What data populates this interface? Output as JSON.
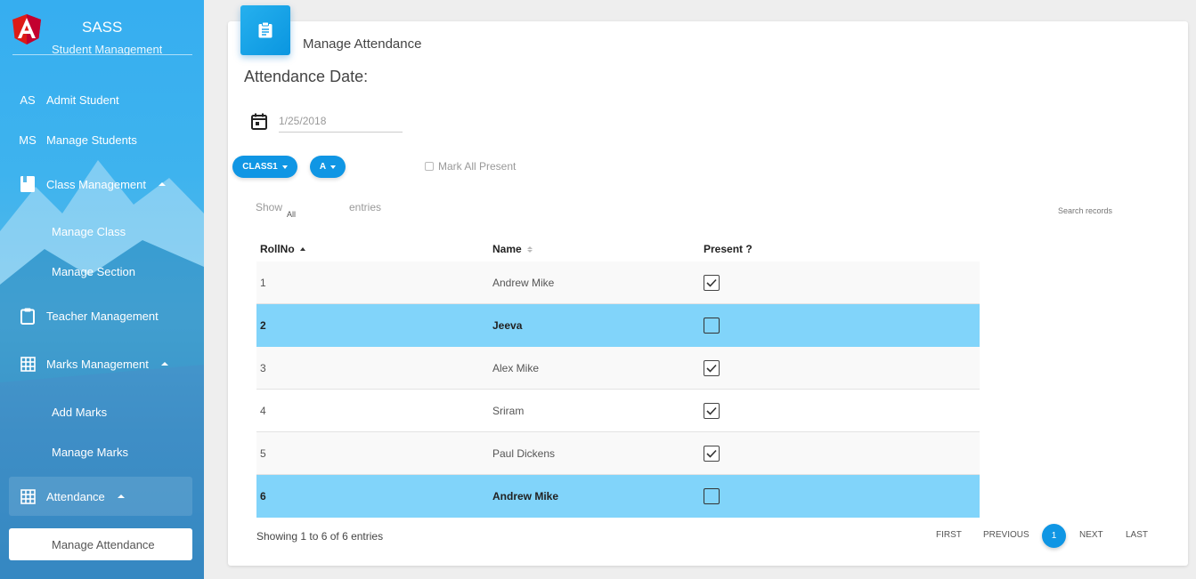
{
  "brand": {
    "name": "SASS"
  },
  "sidebar": {
    "clipped_item": "Student Management",
    "items": [
      {
        "abbr": "AS",
        "label": "Admit Student"
      },
      {
        "abbr": "MS",
        "label": "Manage Students"
      },
      {
        "icon": "book-icon",
        "label": "Class Management"
      },
      {
        "label": "Manage Class"
      },
      {
        "label": "Manage Section"
      },
      {
        "icon": "clipboard-icon",
        "label": "Teacher Management"
      },
      {
        "icon": "grid-icon",
        "label": "Marks Management"
      },
      {
        "label": "Add Marks"
      },
      {
        "label": "Manage Marks"
      },
      {
        "icon": "grid-icon",
        "label": "Attendance"
      },
      {
        "label": "Manage Attendance"
      }
    ]
  },
  "card": {
    "title": "Manage Attendance",
    "icon": "clipboard-icon",
    "attendance_label": "Attendance Date:",
    "date_value": "1/25/2018",
    "class_select": "CLASS1",
    "section_select": "A",
    "mark_all_label": "Mark All Present",
    "show_label": "Show",
    "show_value": "All",
    "entries_label": "entries",
    "search_placeholder": "Search records"
  },
  "table": {
    "headers": {
      "roll": "RollNo",
      "name": "Name",
      "present": "Present ?"
    },
    "rows": [
      {
        "roll": "1",
        "name": "Andrew Mike",
        "present": true
      },
      {
        "roll": "2",
        "name": "Jeeva",
        "present": false
      },
      {
        "roll": "3",
        "name": "Alex Mike",
        "present": true
      },
      {
        "roll": "4",
        "name": "Sriram",
        "present": true
      },
      {
        "roll": "5",
        "name": "Paul Dickens",
        "present": true
      },
      {
        "roll": "6",
        "name": "Andrew Mike",
        "present": false
      }
    ]
  },
  "footer": {
    "showing": "Showing 1 to 6 of 6 entries",
    "first": "FIRST",
    "previous": "PREVIOUS",
    "page": "1",
    "next": "NEXT",
    "last": "LAST"
  },
  "colors": {
    "accent": "#1096e4",
    "absent_row": "#81d4fa",
    "sidebar": "#3eb3ee"
  }
}
